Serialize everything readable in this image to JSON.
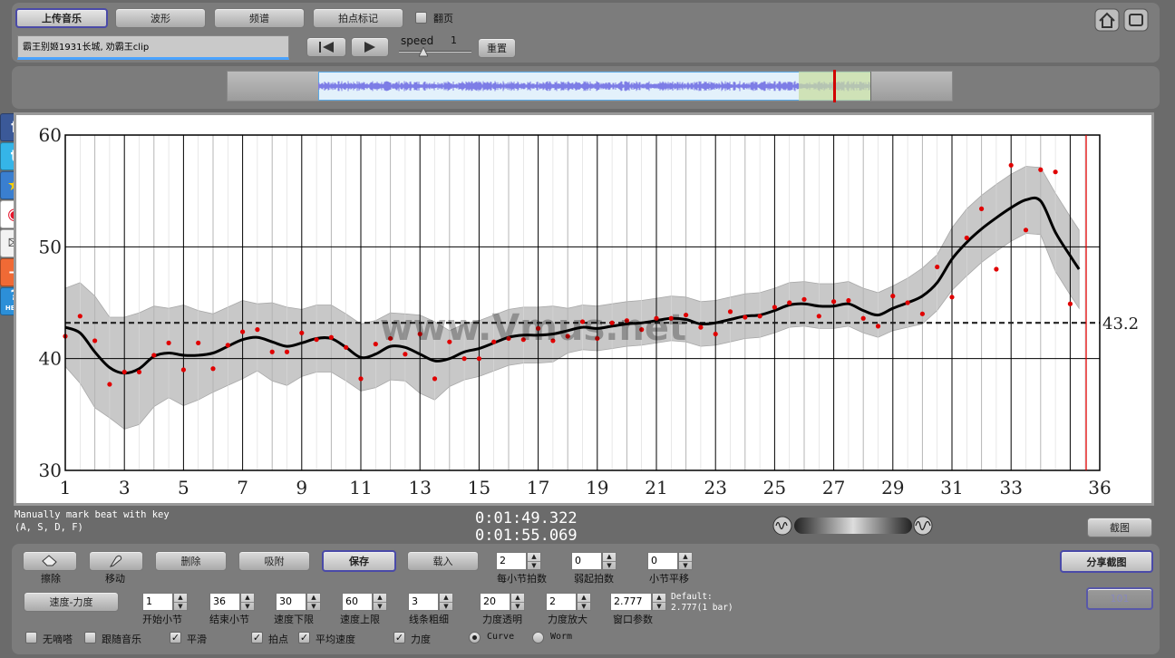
{
  "toolbar": {
    "upload_label": "上传音乐",
    "waveform_label": "波形",
    "spectrum_label": "频谱",
    "beat_mark_label": "拍点标记",
    "flip_label": "翻页",
    "track_title": "霸王别姬1931长城, 劝霸王clip",
    "speed_label": "speed",
    "speed_value": "1",
    "reset_label": "重置"
  },
  "side_icons": [
    "facebook-icon",
    "twitter-icon",
    "star-icon",
    "weibo-icon",
    "mail-icon",
    "plus-icon",
    "help-icon"
  ],
  "side_labels": {
    "facebook": "f",
    "twitter": "t",
    "star": "★",
    "weibo": "◉",
    "mail": "✉",
    "plus": "+",
    "help": "?",
    "help_text": "HELP"
  },
  "chart_data": {
    "type": "line",
    "x_ticks": [
      "1",
      "3",
      "5",
      "7",
      "9",
      "11",
      "13",
      "15",
      "17",
      "19",
      "21",
      "23",
      "25",
      "27",
      "29",
      "31",
      "33",
      "36"
    ],
    "y_ticks": [
      "30",
      "40",
      "50",
      "60"
    ],
    "xlim": [
      1,
      36
    ],
    "ylim": [
      30,
      60
    ],
    "average_value": 43.2,
    "average_label": "43.2",
    "watermark": "www.Vmus.net",
    "grid": true,
    "points": [
      [
        1.0,
        42.0
      ],
      [
        1.5,
        43.8
      ],
      [
        2.0,
        41.6
      ],
      [
        2.5,
        37.7
      ],
      [
        3.0,
        38.8
      ],
      [
        3.5,
        38.8
      ],
      [
        4.0,
        40.3
      ],
      [
        4.5,
        41.4
      ],
      [
        5.0,
        39.0
      ],
      [
        5.5,
        41.4
      ],
      [
        6.0,
        39.1
      ],
      [
        6.5,
        41.2
      ],
      [
        7.0,
        42.4
      ],
      [
        7.5,
        42.6
      ],
      [
        8.0,
        40.6
      ],
      [
        8.5,
        40.6
      ],
      [
        9.0,
        42.3
      ],
      [
        9.5,
        41.7
      ],
      [
        10.0,
        41.9
      ],
      [
        10.5,
        41.0
      ],
      [
        11.0,
        38.2
      ],
      [
        11.5,
        41.3
      ],
      [
        12.0,
        41.8
      ],
      [
        12.5,
        40.4
      ],
      [
        13.0,
        42.2
      ],
      [
        13.5,
        38.2
      ],
      [
        14.0,
        41.5
      ],
      [
        14.5,
        40.0
      ],
      [
        15.0,
        40.0
      ],
      [
        15.5,
        41.5
      ],
      [
        16.0,
        41.8
      ],
      [
        16.5,
        41.7
      ],
      [
        17.0,
        42.7
      ],
      [
        17.5,
        41.6
      ],
      [
        18.0,
        42.0
      ],
      [
        18.5,
        43.3
      ],
      [
        19.0,
        41.8
      ],
      [
        19.5,
        43.2
      ],
      [
        20.0,
        43.4
      ],
      [
        20.5,
        42.6
      ],
      [
        21.0,
        43.6
      ],
      [
        21.5,
        43.6
      ],
      [
        22.0,
        43.9
      ],
      [
        22.5,
        42.8
      ],
      [
        23.0,
        42.2
      ],
      [
        23.5,
        44.2
      ],
      [
        24.0,
        43.7
      ],
      [
        24.5,
        43.8
      ],
      [
        25.0,
        44.6
      ],
      [
        25.5,
        45.0
      ],
      [
        26.0,
        45.3
      ],
      [
        26.5,
        43.8
      ],
      [
        27.0,
        45.1
      ],
      [
        27.5,
        45.2
      ],
      [
        28.0,
        43.6
      ],
      [
        28.5,
        42.9
      ],
      [
        29.0,
        45.6
      ],
      [
        29.5,
        45.0
      ],
      [
        30.0,
        44.0
      ],
      [
        30.5,
        48.2
      ],
      [
        31.0,
        45.5
      ],
      [
        31.5,
        50.8
      ],
      [
        32.0,
        53.4
      ],
      [
        32.5,
        48.0
      ],
      [
        33.0,
        57.3
      ],
      [
        33.5,
        51.5
      ],
      [
        34.0,
        56.9
      ],
      [
        34.5,
        56.7
      ],
      [
        35.0,
        44.9
      ]
    ],
    "curve": [
      [
        1.0,
        42.8
      ],
      [
        1.5,
        42.3
      ],
      [
        2.0,
        40.6
      ],
      [
        2.5,
        39.2
      ],
      [
        3.0,
        38.7
      ],
      [
        3.5,
        39.1
      ],
      [
        4.0,
        40.2
      ],
      [
        4.5,
        40.5
      ],
      [
        5.0,
        40.3
      ],
      [
        5.5,
        40.3
      ],
      [
        6.0,
        40.5
      ],
      [
        6.5,
        41.1
      ],
      [
        7.0,
        41.7
      ],
      [
        7.5,
        41.9
      ],
      [
        8.0,
        41.5
      ],
      [
        8.5,
        41.1
      ],
      [
        9.0,
        41.4
      ],
      [
        9.5,
        41.8
      ],
      [
        10.0,
        41.8
      ],
      [
        10.5,
        41.0
      ],
      [
        11.0,
        40.1
      ],
      [
        11.5,
        40.4
      ],
      [
        12.0,
        41.1
      ],
      [
        12.5,
        41.0
      ],
      [
        13.0,
        40.4
      ],
      [
        13.5,
        39.8
      ],
      [
        14.0,
        40.0
      ],
      [
        14.5,
        40.6
      ],
      [
        15.0,
        40.9
      ],
      [
        15.5,
        41.4
      ],
      [
        16.0,
        41.9
      ],
      [
        16.5,
        42.1
      ],
      [
        17.0,
        42.1
      ],
      [
        17.5,
        42.2
      ],
      [
        18.0,
        42.5
      ],
      [
        18.5,
        42.8
      ],
      [
        19.0,
        42.7
      ],
      [
        19.5,
        42.9
      ],
      [
        20.0,
        43.1
      ],
      [
        20.5,
        43.2
      ],
      [
        21.0,
        43.4
      ],
      [
        21.5,
        43.6
      ],
      [
        22.0,
        43.5
      ],
      [
        22.5,
        43.1
      ],
      [
        23.0,
        43.2
      ],
      [
        23.5,
        43.5
      ],
      [
        24.0,
        43.8
      ],
      [
        24.5,
        43.9
      ],
      [
        25.0,
        44.3
      ],
      [
        25.5,
        44.8
      ],
      [
        26.0,
        44.9
      ],
      [
        26.5,
        44.7
      ],
      [
        27.0,
        44.7
      ],
      [
        27.5,
        44.9
      ],
      [
        28.0,
        44.3
      ],
      [
        28.5,
        43.9
      ],
      [
        29.0,
        44.5
      ],
      [
        29.5,
        45.0
      ],
      [
        30.0,
        45.6
      ],
      [
        30.5,
        46.8
      ],
      [
        31.0,
        48.9
      ],
      [
        31.5,
        50.4
      ],
      [
        32.0,
        51.6
      ],
      [
        32.5,
        52.6
      ],
      [
        33.0,
        53.5
      ],
      [
        33.5,
        54.2
      ],
      [
        34.0,
        54.1
      ],
      [
        34.5,
        51.3
      ],
      [
        35.0,
        49.2
      ],
      [
        35.3,
        48.0
      ]
    ],
    "band_halfwidth": [
      3.5,
      4.5,
      5.0,
      4.5,
      5.0,
      5.0,
      4.5,
      4.0,
      4.5,
      4.0,
      3.5,
      3.5,
      3.5,
      3.0,
      3.5,
      3.5,
      3.0,
      3.0,
      3.0,
      3.0,
      3.0,
      3.0,
      3.0,
      3.0,
      3.5,
      3.5,
      2.5,
      2.5,
      2.5,
      2.5,
      2.5,
      2.5,
      2.5,
      2.5,
      2.0,
      2.0,
      2.0,
      2.0,
      2.0,
      2.0,
      2.0,
      2.0,
      2.0,
      2.0,
      2.0,
      2.0,
      2.0,
      2.0,
      2.0,
      2.0,
      2.0,
      2.0,
      2.0,
      2.0,
      2.0,
      2.0,
      2.0,
      2.2,
      2.5,
      2.5,
      2.8,
      3.0,
      3.0,
      3.0,
      3.0,
      3.0,
      3.0,
      3.5,
      3.5,
      3.5
    ]
  },
  "hint": {
    "line1": "Manually mark beat with key",
    "line2": "(A, S, D, F)"
  },
  "times": {
    "current": "0:01:49.322",
    "total": "0:01:55.069"
  },
  "screenshot_label": "截图",
  "share_label": "分享截图",
  "share_disabled_label": "101",
  "row1": {
    "erase_label": "擦除",
    "move_label": "移动",
    "delete_label": "删除",
    "snap_label": "吸附",
    "save_label": "保存",
    "load_label": "载入",
    "beats_per_bar_value": "2",
    "beats_per_bar_label": "每小节拍数",
    "pickup_value": "0",
    "pickup_label": "弱起拍数",
    "bar_shift_value": "0",
    "bar_shift_label": "小节平移"
  },
  "row2": {
    "mode_label": "速度-力度",
    "start_bar_value": "1",
    "start_bar_label": "开始小节",
    "end_bar_value": "36",
    "end_bar_label": "结束小节",
    "speed_min_value": "30",
    "speed_min_label": "速度下限",
    "speed_max_value": "60",
    "speed_max_label": "速度上限",
    "line_width_value": "3",
    "line_width_label": "线条粗细",
    "opacity_value": "20",
    "opacity_label": "力度透明",
    "dyn_scale_value": "2",
    "dyn_scale_label": "力度放大",
    "window_value": "2.777",
    "window_label": "窗口参数",
    "default_line1": "Default:",
    "default_line2": "2.777(1 bar)"
  },
  "row3": {
    "no_tick_label": "无嘀嗒",
    "follow_label": "跟随音乐",
    "smooth_label": "平滑",
    "beat_points_label": "拍点",
    "avg_speed_label": "平均速度",
    "dynamics_label": "力度",
    "curve_label": "Curve",
    "worm_label": "Worm"
  },
  "check_mark": "✓",
  "arrow_up": "▲",
  "arrow_down": "▼"
}
